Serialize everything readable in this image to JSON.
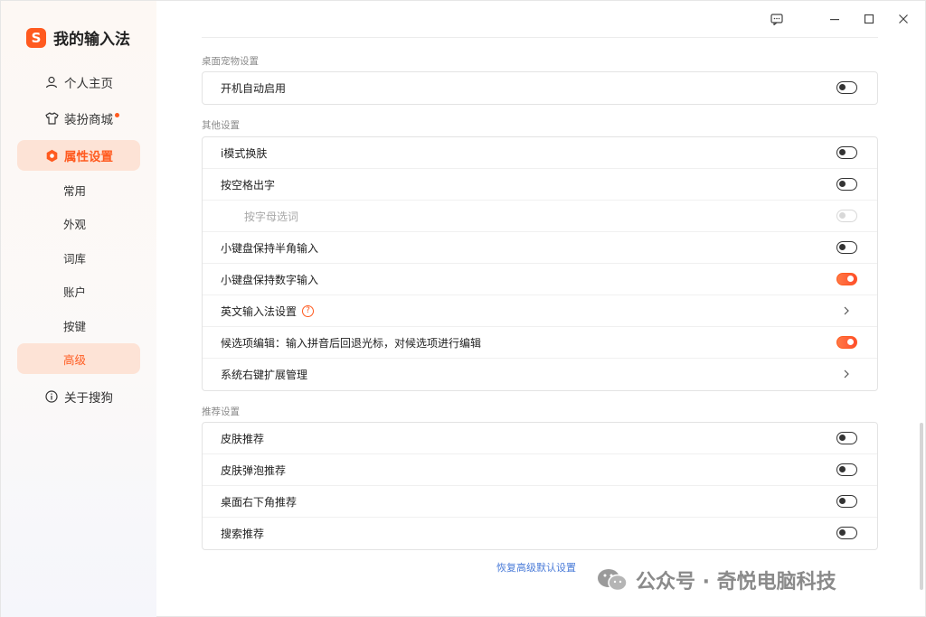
{
  "app": {
    "logo_letter": "S",
    "title": "我的输入法"
  },
  "nav": {
    "home": "个人主页",
    "store": "装扮商城",
    "settings": "属性设置",
    "sub": [
      "常用",
      "外观",
      "词库",
      "账户",
      "按键",
      "高级"
    ],
    "about": "关于搜狗"
  },
  "sections": {
    "pet": {
      "title": "桌面宠物设置",
      "rows": [
        {
          "label": "开机自动启用",
          "state": "off"
        }
      ]
    },
    "other": {
      "title": "其他设置",
      "rows": [
        {
          "label": "i模式换肤",
          "state": "off"
        },
        {
          "label": "按空格出字",
          "state": "off"
        },
        {
          "label": "按字母选词",
          "state": "disabled"
        },
        {
          "label": "小键盘保持半角输入",
          "state": "off"
        },
        {
          "label": "小键盘保持数字输入",
          "state": "on"
        },
        {
          "label": "英文输入法设置",
          "help": "?"
        },
        {
          "label": "候选项编辑：输入拼音后回退光标，对候选项进行编辑",
          "state": "on"
        },
        {
          "label": "系统右键扩展管理"
        }
      ]
    },
    "recommend": {
      "title": "推荐设置",
      "rows": [
        {
          "label": "皮肤推荐",
          "state": "off"
        },
        {
          "label": "皮肤弹泡推荐",
          "state": "off"
        },
        {
          "label": "桌面右下角推荐",
          "state": "off"
        },
        {
          "label": "搜索推荐",
          "state": "off"
        }
      ]
    }
  },
  "reset_label": "恢复高级默认设置",
  "watermark": "公众号 · 奇悦电脑科技",
  "colors": {
    "accent": "#ff5a1f",
    "active_bg": "#fde3d6",
    "link": "#4a7bd8"
  },
  "icons": [
    "feedback-icon",
    "minimize-icon",
    "maximize-icon",
    "close-icon",
    "user-icon",
    "shirt-icon",
    "gear-icon",
    "info-icon",
    "chevron-right-icon",
    "wechat-icon"
  ]
}
